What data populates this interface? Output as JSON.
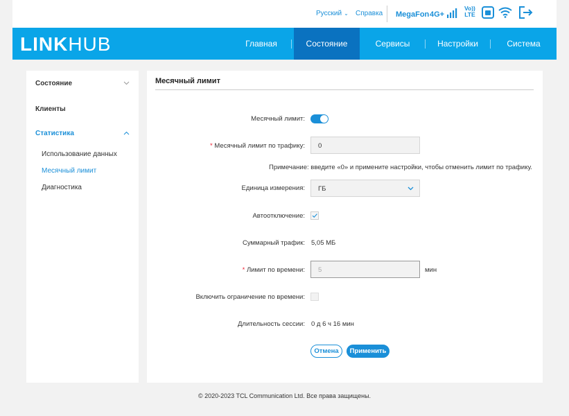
{
  "topbar": {
    "language": "Русский",
    "help": "Справка",
    "operator": "MegaFon",
    "network": "4G+",
    "volte_top": "Vo))",
    "volte_bottom": "LTE"
  },
  "header": {
    "logo_bold": "LINK",
    "logo_light": "HUB",
    "nav": [
      "Главная",
      "Состояние",
      "Сервисы",
      "Настройки",
      "Система"
    ],
    "active_index": 1
  },
  "sidebar": {
    "status": "Состояние",
    "clients": "Клиенты",
    "statistics": "Статистика",
    "data_usage": "Использование данных",
    "monthly_limit": "Месячный лимит",
    "diagnostics": "Диагностика"
  },
  "main": {
    "title": "Месячный лимит",
    "monthly_limit_label": "Месячный лимит:",
    "traffic_limit_label": "Месячный лимит по трафику:",
    "traffic_limit_value": "0",
    "note": "Примечание: введите «0» и примените настройки, чтобы отменить лимит по трафику.",
    "unit_label": "Единица измерения:",
    "unit_value": "ГБ",
    "auto_disconnect_label": "Автоотключение:",
    "total_traffic_label": "Суммарный трафик:",
    "total_traffic_value": "5,05 МБ",
    "time_limit_label": "Лимит по времени:",
    "time_limit_value": "5",
    "time_unit": "мин",
    "enable_time_limit_label": "Включить ограничение по времени:",
    "session_label": "Длительность сессии:",
    "session_value": "0 д 6 ч 16 мин",
    "cancel": "Отмена",
    "apply": "Применить"
  },
  "footer": "© 2020-2023 TCL Communication Ltd. Все права защищены.",
  "colors": {
    "accent": "#0aa5e8",
    "active_nav": "#0a72c0",
    "link": "#1a8fd8"
  }
}
